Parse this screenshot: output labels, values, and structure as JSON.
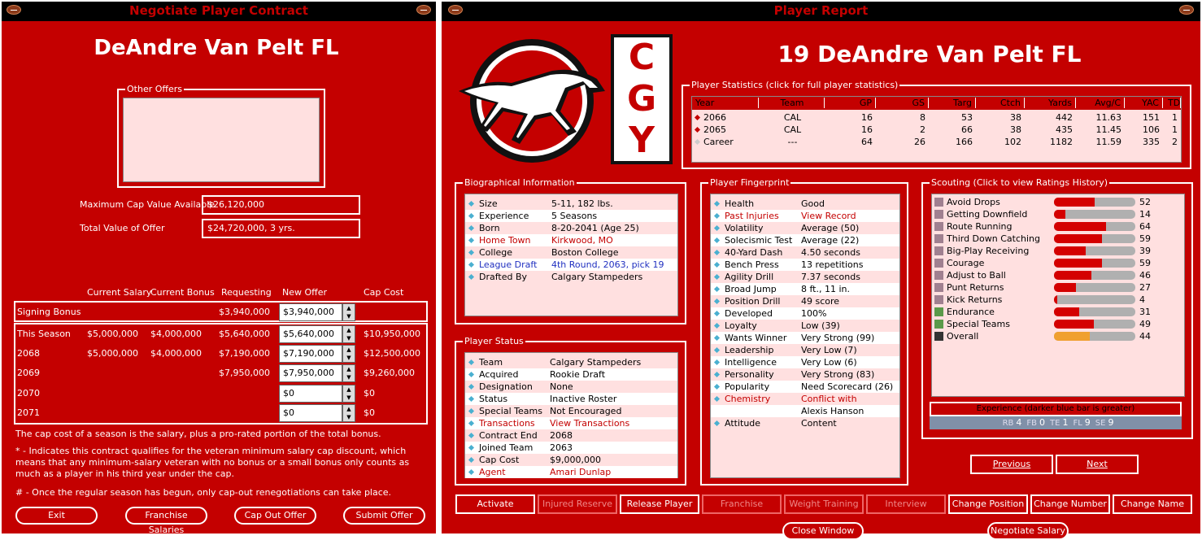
{
  "negotiate": {
    "title": "Negotiate Player Contract",
    "player_name": "DeAndre Van Pelt  FL",
    "other_offers_label": "Other Offers",
    "max_cap_label": "Maximum Cap Value Available",
    "max_cap_value": "$26,120,000",
    "total_value_label": "Total Value of Offer",
    "total_value_value": "$24,720,000, 3 yrs.",
    "columns": [
      "Current Salary",
      "Current Bonus",
      "Requesting",
      "New Offer",
      "Cap Cost"
    ],
    "rows": [
      {
        "label": "Signing Bonus",
        "salary": "",
        "bonus": "",
        "requesting": "$3,940,000",
        "offer": "$3,940,000",
        "cap": ""
      },
      {
        "label": "This Season",
        "salary": "$5,000,000",
        "bonus": "$4,000,000",
        "requesting": "$5,640,000",
        "offer": "$5,640,000",
        "cap": "$10,950,000"
      },
      {
        "label": "2068",
        "salary": "$5,000,000",
        "bonus": "$4,000,000",
        "requesting": "$7,190,000",
        "offer": "$7,190,000",
        "cap": "$12,500,000"
      },
      {
        "label": "2069",
        "salary": "",
        "bonus": "",
        "requesting": "$7,950,000",
        "offer": "$7,950,000",
        "cap": "$9,260,000"
      },
      {
        "label": "2070",
        "salary": "",
        "bonus": "",
        "requesting": "",
        "offer": "$0",
        "cap": "$0"
      },
      {
        "label": "2071",
        "salary": "",
        "bonus": "",
        "requesting": "",
        "offer": "$0",
        "cap": "$0"
      }
    ],
    "note1": "The cap cost of a season is the salary, plus a pro-rated portion of the total bonus.",
    "note2": "* - Indicates this contract qualifies for the veteran minimum salary cap discount, which means that any minimum-salary veteran with no bonus or a small bonus only counts as much as a player in his third year under the cap.",
    "note3": "# - Once the regular season has begun, only cap-out renegotiations can take place.",
    "buttons": {
      "exit": "Exit",
      "franchise_salaries": "Franchise Salaries",
      "cap_out": "Cap Out Offer",
      "submit": "Submit Offer"
    }
  },
  "report": {
    "title": "Player Report",
    "player_name": "19  DeAndre Van Pelt  FL",
    "team_logo_letters": [
      "C",
      "G",
      "Y"
    ],
    "stats": {
      "legend": "Player Statistics (click for full player statistics)",
      "headers": [
        "Year",
        "Team",
        "GP",
        "GS",
        "Targ",
        "Ctch",
        "Yards",
        "Avg/C",
        "YAC",
        "TD"
      ],
      "rows": [
        [
          "2066",
          "CAL",
          "16",
          "8",
          "53",
          "38",
          "442",
          "11.63",
          "151",
          "1"
        ],
        [
          "2065",
          "CAL",
          "16",
          "2",
          "66",
          "38",
          "435",
          "11.45",
          "106",
          "1"
        ],
        [
          "Career",
          "---",
          "64",
          "26",
          "166",
          "102",
          "1182",
          "11.59",
          "335",
          "2"
        ]
      ]
    },
    "bio": {
      "legend": "Biographical Information",
      "rows": [
        {
          "k": "Size",
          "v": "5-11, 182 lbs.",
          "style": ""
        },
        {
          "k": "Experience",
          "v": "5 Seasons",
          "style": ""
        },
        {
          "k": "Born",
          "v": "8-20-2041 (Age 25)",
          "style": ""
        },
        {
          "k": "Home Town",
          "v": "Kirkwood, MO",
          "style": "red"
        },
        {
          "k": "College",
          "v": "Boston College",
          "style": ""
        },
        {
          "k": "League Draft",
          "v": "4th Round, 2063, pick 19",
          "style": "blue"
        },
        {
          "k": "Drafted By",
          "v": "Calgary Stampeders",
          "style": ""
        }
      ]
    },
    "status": {
      "legend": "Player Status",
      "rows": [
        {
          "k": "Team",
          "v": "Calgary Stampeders",
          "style": ""
        },
        {
          "k": "Acquired",
          "v": "Rookie Draft",
          "style": ""
        },
        {
          "k": "Designation",
          "v": "None",
          "style": ""
        },
        {
          "k": "Status",
          "v": "Inactive Roster",
          "style": ""
        },
        {
          "k": "Special Teams",
          "v": "Not Encouraged",
          "style": ""
        },
        {
          "k": "Transactions",
          "v": "View Transactions",
          "style": "red"
        },
        {
          "k": "Contract End",
          "v": "2068",
          "style": ""
        },
        {
          "k": "Joined Team",
          "v": "2063",
          "style": ""
        },
        {
          "k": "Cap Cost",
          "v": "$9,000,000",
          "style": ""
        },
        {
          "k": "Agent",
          "v": "Amari Dunlap",
          "style": "red"
        }
      ]
    },
    "fingerprint": {
      "legend": "Player Fingerprint",
      "rows": [
        {
          "k": "Health",
          "v": "Good",
          "style": "",
          "dia": true
        },
        {
          "k": "Past Injuries",
          "v": "View Record",
          "style": "red",
          "dia": true
        },
        {
          "k": "Volatility",
          "v": "Average (50)",
          "style": "",
          "dia": true
        },
        {
          "k": "Solecismic Test",
          "v": "Average (22)",
          "style": "",
          "dia": true
        },
        {
          "k": "40-Yard Dash",
          "v": "4.50 seconds",
          "style": "",
          "dia": true
        },
        {
          "k": "Bench Press",
          "v": "13 repetitions",
          "style": "",
          "dia": true
        },
        {
          "k": "Agility Drill",
          "v": "7.37 seconds",
          "style": "",
          "dia": true
        },
        {
          "k": "Broad Jump",
          "v": "8 ft., 11 in.",
          "style": "",
          "dia": true
        },
        {
          "k": "Position Drill",
          "v": "49 score",
          "style": "",
          "dia": true
        },
        {
          "k": "Developed",
          "v": "100%",
          "style": "",
          "dia": true
        },
        {
          "k": "Loyalty",
          "v": "Low (39)",
          "style": "",
          "dia": true
        },
        {
          "k": "Wants Winner",
          "v": "Very Strong (99)",
          "style": "",
          "dia": true
        },
        {
          "k": "Leadership",
          "v": "Very Low (7)",
          "style": "",
          "dia": true
        },
        {
          "k": "Intelligence",
          "v": "Very Low (6)",
          "style": "",
          "dia": true
        },
        {
          "k": "Personality",
          "v": "Very Strong (83)",
          "style": "",
          "dia": true
        },
        {
          "k": "Popularity",
          "v": "Need Scorecard (26)",
          "style": "",
          "dia": true
        },
        {
          "k": "Chemistry",
          "v": "Conflict with",
          "style": "red",
          "dia": true
        },
        {
          "k": "",
          "v": "Alexis Hanson",
          "style": "",
          "dia": false
        },
        {
          "k": "Attitude",
          "v": "Content",
          "style": "",
          "dia": true
        }
      ]
    },
    "scouting": {
      "legend": "Scouting (Click to view Ratings History)",
      "rows": [
        {
          "k": "Avoid Drops",
          "v": "52",
          "fill": 0.5,
          "sq": "#a08090"
        },
        {
          "k": "Getting Downfield",
          "v": "14",
          "fill": 0.14,
          "sq": "#a08090"
        },
        {
          "k": "Route Running",
          "v": "64",
          "fill": 0.64,
          "sq": "#a08090"
        },
        {
          "k": "Third Down Catching",
          "v": "59",
          "fill": 0.59,
          "sq": "#a08090"
        },
        {
          "k": "Big-Play Receiving",
          "v": "39",
          "fill": 0.39,
          "sq": "#a08090"
        },
        {
          "k": "Courage",
          "v": "59",
          "fill": 0.59,
          "sq": "#a08090"
        },
        {
          "k": "Adjust to Ball",
          "v": "46",
          "fill": 0.46,
          "sq": "#a08090"
        },
        {
          "k": "Punt Returns",
          "v": "27",
          "fill": 0.27,
          "sq": "#a08090"
        },
        {
          "k": "Kick Returns",
          "v": "4",
          "fill": 0.04,
          "sq": "#a08090"
        },
        {
          "k": "Endurance",
          "v": "31",
          "fill": 0.31,
          "sq": "#5a9a4a"
        },
        {
          "k": "Special Teams",
          "v": "49",
          "fill": 0.49,
          "sq": "#5a9a4a"
        },
        {
          "k": "Overall",
          "v": "44",
          "fill": 0.44,
          "sq": "#333333"
        }
      ],
      "experience_label": "Experience (darker blue bar is greater)",
      "experience_positions": [
        {
          "pos": "RB",
          "val": "4"
        },
        {
          "pos": "FB",
          "val": "0"
        },
        {
          "pos": "TE",
          "val": "1"
        },
        {
          "pos": "FL",
          "val": "9"
        },
        {
          "pos": "SE",
          "val": "9"
        }
      ]
    },
    "nav": {
      "previous": "Previous",
      "next": "Next"
    },
    "actions": [
      {
        "label": "Activate",
        "enabled": true
      },
      {
        "label": "Injured Reserve",
        "enabled": false
      },
      {
        "label": "Release Player",
        "enabled": true
      },
      {
        "label": "Franchise",
        "enabled": false
      },
      {
        "label": "Weight Training",
        "enabled": false
      },
      {
        "label": "Interview",
        "enabled": false
      },
      {
        "label": "Change Position",
        "enabled": true
      },
      {
        "label": "Change Number",
        "enabled": true
      },
      {
        "label": "Change Name",
        "enabled": true
      }
    ],
    "bottom": {
      "close": "Close Window",
      "negotiate": "Negotiate Salary"
    }
  }
}
